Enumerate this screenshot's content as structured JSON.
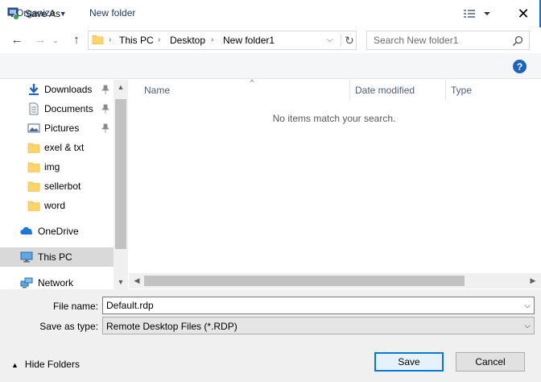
{
  "window": {
    "title": "Save As",
    "close_glyph": "✕"
  },
  "nav_buttons": {
    "back": "←",
    "forward": "→",
    "recent": "⌄",
    "up": "↑"
  },
  "address": {
    "crumbs": [
      "This PC",
      "Desktop",
      "New folder1"
    ],
    "separator": "›",
    "dropdown_glyph": "⌵",
    "refresh_glyph": "↻"
  },
  "search": {
    "placeholder": "Search New folder1",
    "value": ""
  },
  "toolbar": {
    "organize_label": "Organize",
    "organize_arrow": "▼",
    "new_folder_label": "New folder",
    "help_label": "?"
  },
  "sidebar": {
    "items": [
      {
        "label": "Downloads",
        "icon": "download-icon"
      },
      {
        "label": "Documents",
        "icon": "documents-icon"
      },
      {
        "label": "Pictures",
        "icon": "pictures-icon"
      },
      {
        "label": "exel & txt",
        "icon": "folder-icon"
      },
      {
        "label": "img",
        "icon": "folder-icon"
      },
      {
        "label": "sellerbot",
        "icon": "folder-icon"
      },
      {
        "label": "word",
        "icon": "folder-icon"
      },
      {
        "label": "OneDrive",
        "icon": "onedrive-icon"
      },
      {
        "label": "This PC",
        "icon": "computer-icon",
        "selected": true
      },
      {
        "label": "Network",
        "icon": "network-icon"
      }
    ],
    "scroll_up": "▲",
    "scroll_down": "▼"
  },
  "filelist": {
    "columns": [
      "Name",
      "Date modified",
      "Type"
    ],
    "sort_glyph": "^",
    "empty_message": "No items match your search.",
    "scroll_left": "◀",
    "scroll_right": "▶"
  },
  "form": {
    "filename_label": "File name:",
    "filename_value": "Default.rdp",
    "savetype_label": "Save as type:",
    "savetype_value": "Remote Desktop Files (*.RDP)",
    "dropdown_glyph": "⌵"
  },
  "footer": {
    "hide_folders_arrow": "▲",
    "hide_folders_label": "Hide Folders",
    "save_label": "Save",
    "cancel_label": "Cancel"
  },
  "colors": {
    "accent": "#0078d7",
    "help_blue": "#1c64c0",
    "folder_yellow": "#ffd666",
    "link_text": "#1e395b"
  }
}
